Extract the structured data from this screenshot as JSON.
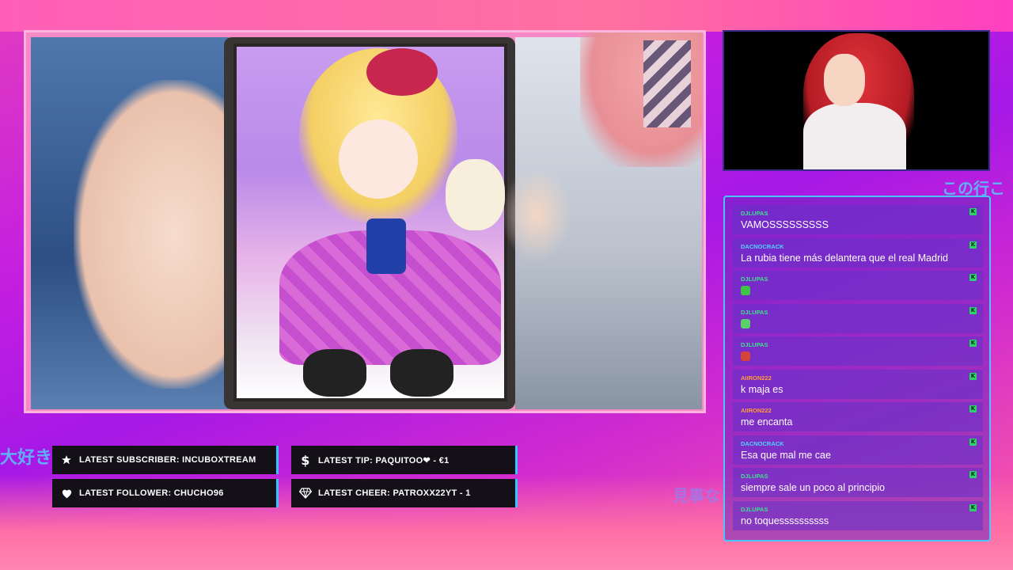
{
  "overlay": {
    "jp_left": "大好き",
    "jp_right": "この行こ",
    "jp_mid": "見事な"
  },
  "stats": {
    "latest_subscriber": "LATEST SUBSCRIBER: INCUBOXTREAM",
    "latest_tip": "LATEST TIP: PAQUITOO❤ - €1",
    "latest_follower": "LATEST FOLLOWER: CHUCHO96",
    "latest_cheer": "LATEST CHEER: PATROXX22YT - 1"
  },
  "icons": {
    "subscriber": "star-icon",
    "tip": "dollar-icon",
    "follower": "heart-icon",
    "cheer": "diamond-icon"
  },
  "colors": {
    "accent": "#34c4ff",
    "user_green": "#2bd46b",
    "user_cyan": "#4fd3ff",
    "user_orange": "#ff9a3c"
  },
  "chat": {
    "messages": [
      {
        "user": "DJLUPAS",
        "text": "VAMOSSSSSSSSS",
        "user_color": "#3fe08a"
      },
      {
        "user": "DACNOCRACK",
        "text": "La rubia tiene más delantera que el real Madrid",
        "user_color": "#4fd3ff"
      },
      {
        "user": "DJLUPAS",
        "text": "",
        "user_color": "#3fe08a",
        "emote_color": "#3fc44a"
      },
      {
        "user": "DJLUPAS",
        "text": "",
        "user_color": "#3fe08a",
        "emote_color": "#5bd06a"
      },
      {
        "user": "DJLUPAS",
        "text": "",
        "user_color": "#3fe08a",
        "emote_color": "#d4443a"
      },
      {
        "user": "AIIRON222",
        "text": "k maja es",
        "user_color": "#ff9a3c"
      },
      {
        "user": "AIIRON222",
        "text": "me encanta",
        "user_color": "#ff9a3c"
      },
      {
        "user": "DACNOCRACK",
        "text": "Esa que mal me cae",
        "user_color": "#4fd3ff"
      },
      {
        "user": "DJLUPAS",
        "text": "siempre sale un poco al principio",
        "user_color": "#3fe08a"
      },
      {
        "user": "DJLUPAS",
        "text": "no toquessssssssss",
        "user_color": "#3fe08a"
      }
    ]
  }
}
